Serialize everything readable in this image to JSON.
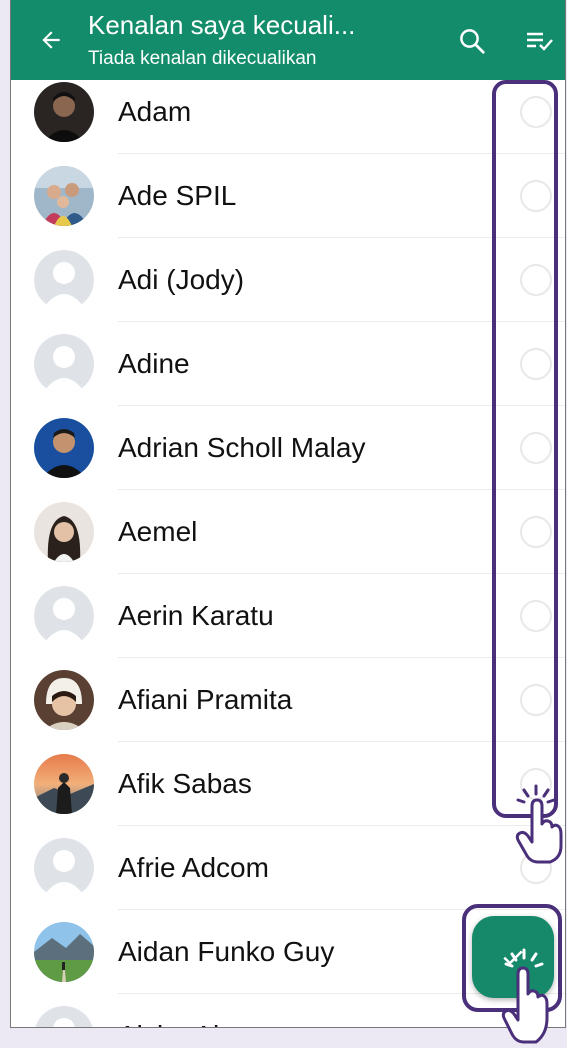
{
  "header": {
    "title": "Kenalan saya kecuali...",
    "subtitle": "Tiada kenalan dikecualikan",
    "back_icon": "arrow-left-icon",
    "search_icon": "search-icon",
    "select_all_icon": "select-all-icon"
  },
  "colors": {
    "appbar": "#128c6a",
    "fab": "#16896b",
    "highlight": "#4a2f7a"
  },
  "contacts": [
    {
      "name": "Adam",
      "checked": false
    },
    {
      "name": "Ade SPIL",
      "checked": false
    },
    {
      "name": "Adi (Jody)",
      "checked": false
    },
    {
      "name": "Adine",
      "checked": false
    },
    {
      "name": "Adrian Scholl Malay",
      "checked": false
    },
    {
      "name": "Aemel",
      "checked": false
    },
    {
      "name": "Aerin Karatu",
      "checked": false
    },
    {
      "name": "Afiani Pramita",
      "checked": false
    },
    {
      "name": "Afik Sabas",
      "checked": false
    },
    {
      "name": "Afrie Adcom",
      "checked": false
    },
    {
      "name": "Aidan Funko Guy",
      "checked": false
    },
    {
      "name": "Aisha Al...",
      "checked": false
    }
  ],
  "fab": {
    "icon": "checkmark-icon"
  }
}
